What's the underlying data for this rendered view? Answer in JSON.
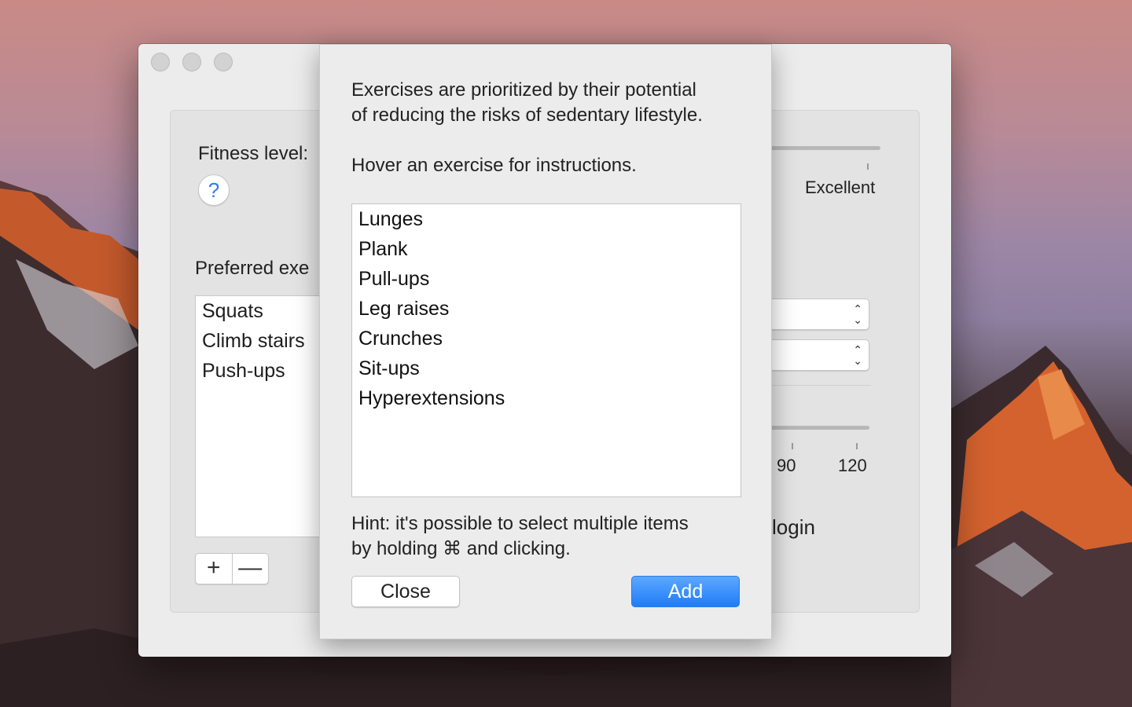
{
  "window": {
    "fitness_label": "Fitness level:",
    "help_button": "?",
    "slider_label_excellent": "Excellent",
    "preferred_label": "Preferred exe",
    "preferred_exercises": [
      "Squats",
      "Climb stairs",
      "Push-ups"
    ],
    "add_label": "+",
    "remove_label": "—",
    "duration_ticks": [
      "90",
      "120"
    ],
    "login_label": "login"
  },
  "sheet": {
    "intro_line1": "Exercises are prioritized by their potential",
    "intro_line2": "of reducing the risks of sedentary lifestyle.",
    "hover_text": "Hover an exercise for instructions.",
    "exercises": [
      "Lunges",
      "Plank",
      "Pull-ups",
      "Leg raises",
      "Crunches",
      "Sit-ups",
      "Hyperextensions"
    ],
    "hint_line1": "Hint: it's possible to select multiple items",
    "hint_line2": "by holding ⌘ and clicking.",
    "close_label": "Close",
    "add_label": "Add"
  },
  "colors": {
    "accent": "#1f7cf6",
    "window_bg": "#ececec"
  }
}
